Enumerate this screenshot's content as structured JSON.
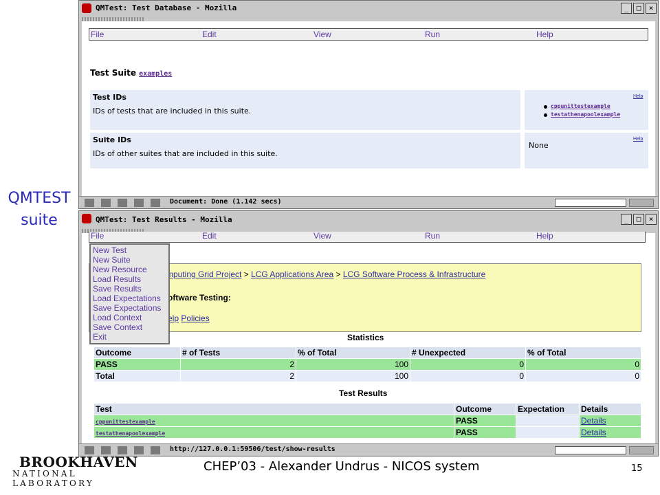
{
  "side_label": {
    "line1": "QMTEST",
    "line2": "suite"
  },
  "window1": {
    "title": "QMTest: Test Database - Mozilla",
    "controls": {
      "minimize": "_",
      "maximize": "□",
      "close": "×"
    },
    "menu": [
      "File",
      "Edit",
      "View",
      "Run",
      "Help"
    ],
    "suite_heading": "Test Suite",
    "suite_name": "examples",
    "fields": [
      {
        "name": "Test IDs",
        "description": "IDs of tests that are included in this suite.",
        "help": "Help",
        "values": [
          "cppunittestexample",
          "testathenapoolexample"
        ]
      },
      {
        "name": "Suite IDs",
        "description": "IDs of other suites that are included in this suite.",
        "help": "Help",
        "value_text": "None"
      }
    ],
    "status": "Document: Done (1.142 secs)"
  },
  "window2": {
    "title": "QMTest: Test Results - Mozilla",
    "controls": {
      "minimize": "_",
      "maximize": "□",
      "close": "×"
    },
    "menu": [
      "File",
      "Edit",
      "View",
      "Run",
      "Help"
    ],
    "file_menu_items": [
      "New Test",
      "New Suite",
      "New Resource",
      "Load Results",
      "Save Results",
      "Load Expectations",
      "Save Expectations",
      "Load Context",
      "Save Context",
      "Exit"
    ],
    "breadcrumb": {
      "first": "mputing Grid Project",
      "sep": " > ",
      "second": "LCG Applications Area",
      "third": "LCG Software Process & Infrastructure"
    },
    "heading_fragment": "oftware Testing:",
    "links": {
      "help": "elp",
      "policies": "Policies"
    },
    "statistics": {
      "title": "Statistics",
      "headers": [
        "Outcome",
        "# of Tests",
        "% of Total",
        "# Unexpected",
        "% of Total"
      ],
      "rows": [
        {
          "outcome": "PASS",
          "tests": "2",
          "pct": "100",
          "unexpected": "0",
          "pct_unexpected": "0"
        },
        {
          "outcome": "Total",
          "tests": "2",
          "pct": "100",
          "unexpected": "0",
          "pct_unexpected": "0"
        }
      ]
    },
    "results": {
      "title": "Test Results",
      "headers": [
        "Test",
        "Outcome",
        "Expectation",
        "Details"
      ],
      "rows": [
        {
          "test": "cppunittestexample",
          "outcome": "PASS",
          "expectation": "",
          "details": "Details"
        },
        {
          "test": "testathenapoolexample",
          "outcome": "PASS",
          "expectation": "",
          "details": "Details"
        }
      ]
    },
    "status": "http://127.0.0.1:59506/test/show-results"
  },
  "footer": {
    "logo_line1": "BROOKHAVEN",
    "logo_line2": "NATIONAL LABORATORY",
    "caption": "CHEP’03  -  Alexander Undrus  -  NICOS system",
    "page": "15"
  }
}
